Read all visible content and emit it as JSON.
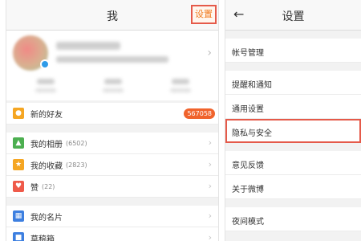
{
  "left": {
    "title": "我",
    "settings_label": "设置",
    "rows_group1": [
      {
        "label": "新的好友",
        "icon": "friends-icon",
        "color": "#f5a623",
        "badge": "567058"
      }
    ],
    "rows_group2": [
      {
        "label": "我的相册",
        "count": "(6502)",
        "icon": "album-icon",
        "color": "#4caf50"
      },
      {
        "label": "我的收藏",
        "count": "(2823)",
        "icon": "star-icon",
        "color": "#f5a623"
      },
      {
        "label": "赞",
        "count": "(22)",
        "icon": "thumbs-up-icon",
        "color": "#ef5a4a"
      }
    ],
    "rows_group3": [
      {
        "label": "我的名片",
        "icon": "card-icon",
        "color": "#3d7fe0"
      },
      {
        "label": "草稿箱",
        "icon": "draft-icon",
        "color": "#3d7fe0"
      }
    ]
  },
  "right": {
    "title": "设置",
    "back_icon": "back-arrow-icon",
    "groups": [
      [
        "帐号管理"
      ],
      [
        "提醒和通知",
        "通用设置",
        "隐私与安全"
      ],
      [
        "意见反馈",
        "关于微博"
      ],
      [
        "夜间模式"
      ]
    ],
    "highlighted": "隐私与安全"
  },
  "colors": {
    "highlight_border": "#e55a4a",
    "settings_text": "#f07b1e",
    "badge_bg": "#f0632c"
  }
}
